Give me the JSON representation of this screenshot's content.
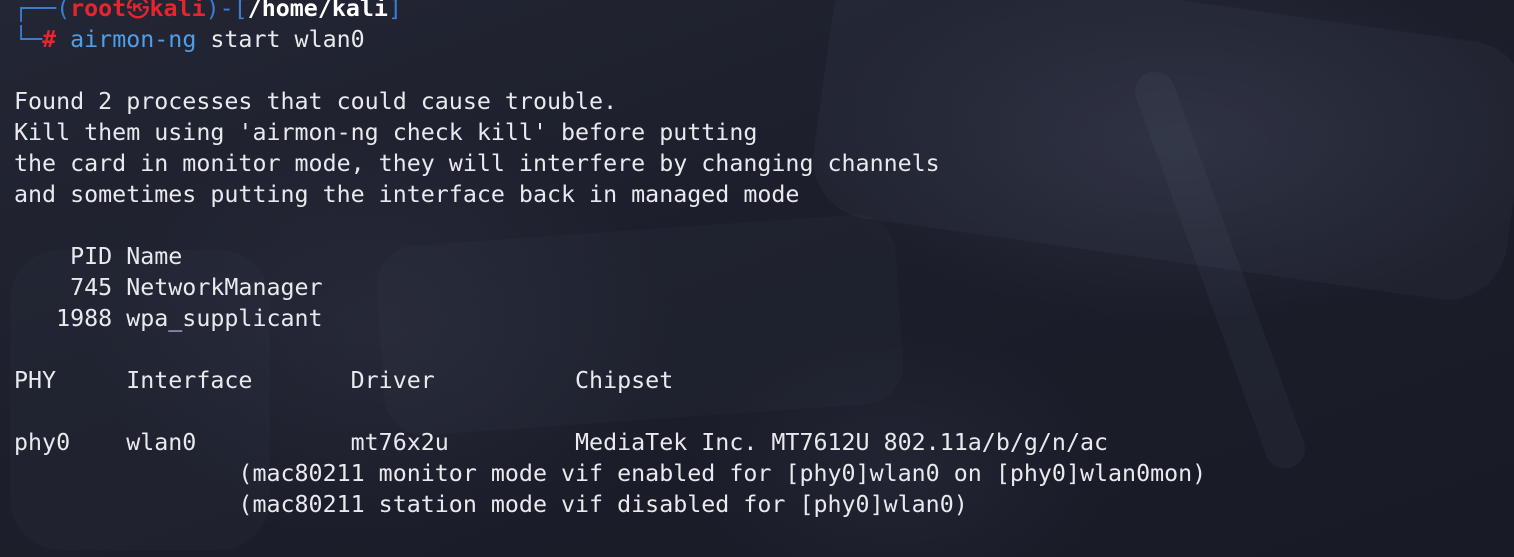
{
  "prompt": {
    "frame_top_left": "┌──(",
    "user": "root",
    "at_symbol": "㉿",
    "host": "kali",
    "frame_mid": ")-[",
    "cwd": "/home/kali",
    "frame_top_right": "]",
    "frame_bottom": "└─",
    "hash": "#",
    "command_name": "airmon-ng",
    "command_args": " start wlan0"
  },
  "output": {
    "warning_lines": [
      "Found 2 processes that could cause trouble.",
      "Kill them using 'airmon-ng check kill' before putting",
      "the card in monitor mode, they will interfere by changing channels",
      "and sometimes putting the interface back in managed mode"
    ],
    "process_header": "    PID Name",
    "processes": [
      "    745 NetworkManager",
      "   1988 wpa_supplicant"
    ],
    "interface_header": "PHY     Interface       Driver          Chipset",
    "interface_row": "phy0    wlan0           mt76x2u         MediaTek Inc. MT7612U 802.11a/b/g/n/ac",
    "status_lines": [
      "                (mac80211 monitor mode vif enabled for [phy0]wlan0 on [phy0]wlan0mon)",
      "                (mac80211 station mode vif disabled for [phy0]wlan0)"
    ]
  },
  "colors": {
    "background": "#1b1d29",
    "prompt_frame": "#3d7bd6",
    "prompt_user": "#e8242f",
    "command": "#4f9fe8",
    "text": "#e9eaee"
  }
}
